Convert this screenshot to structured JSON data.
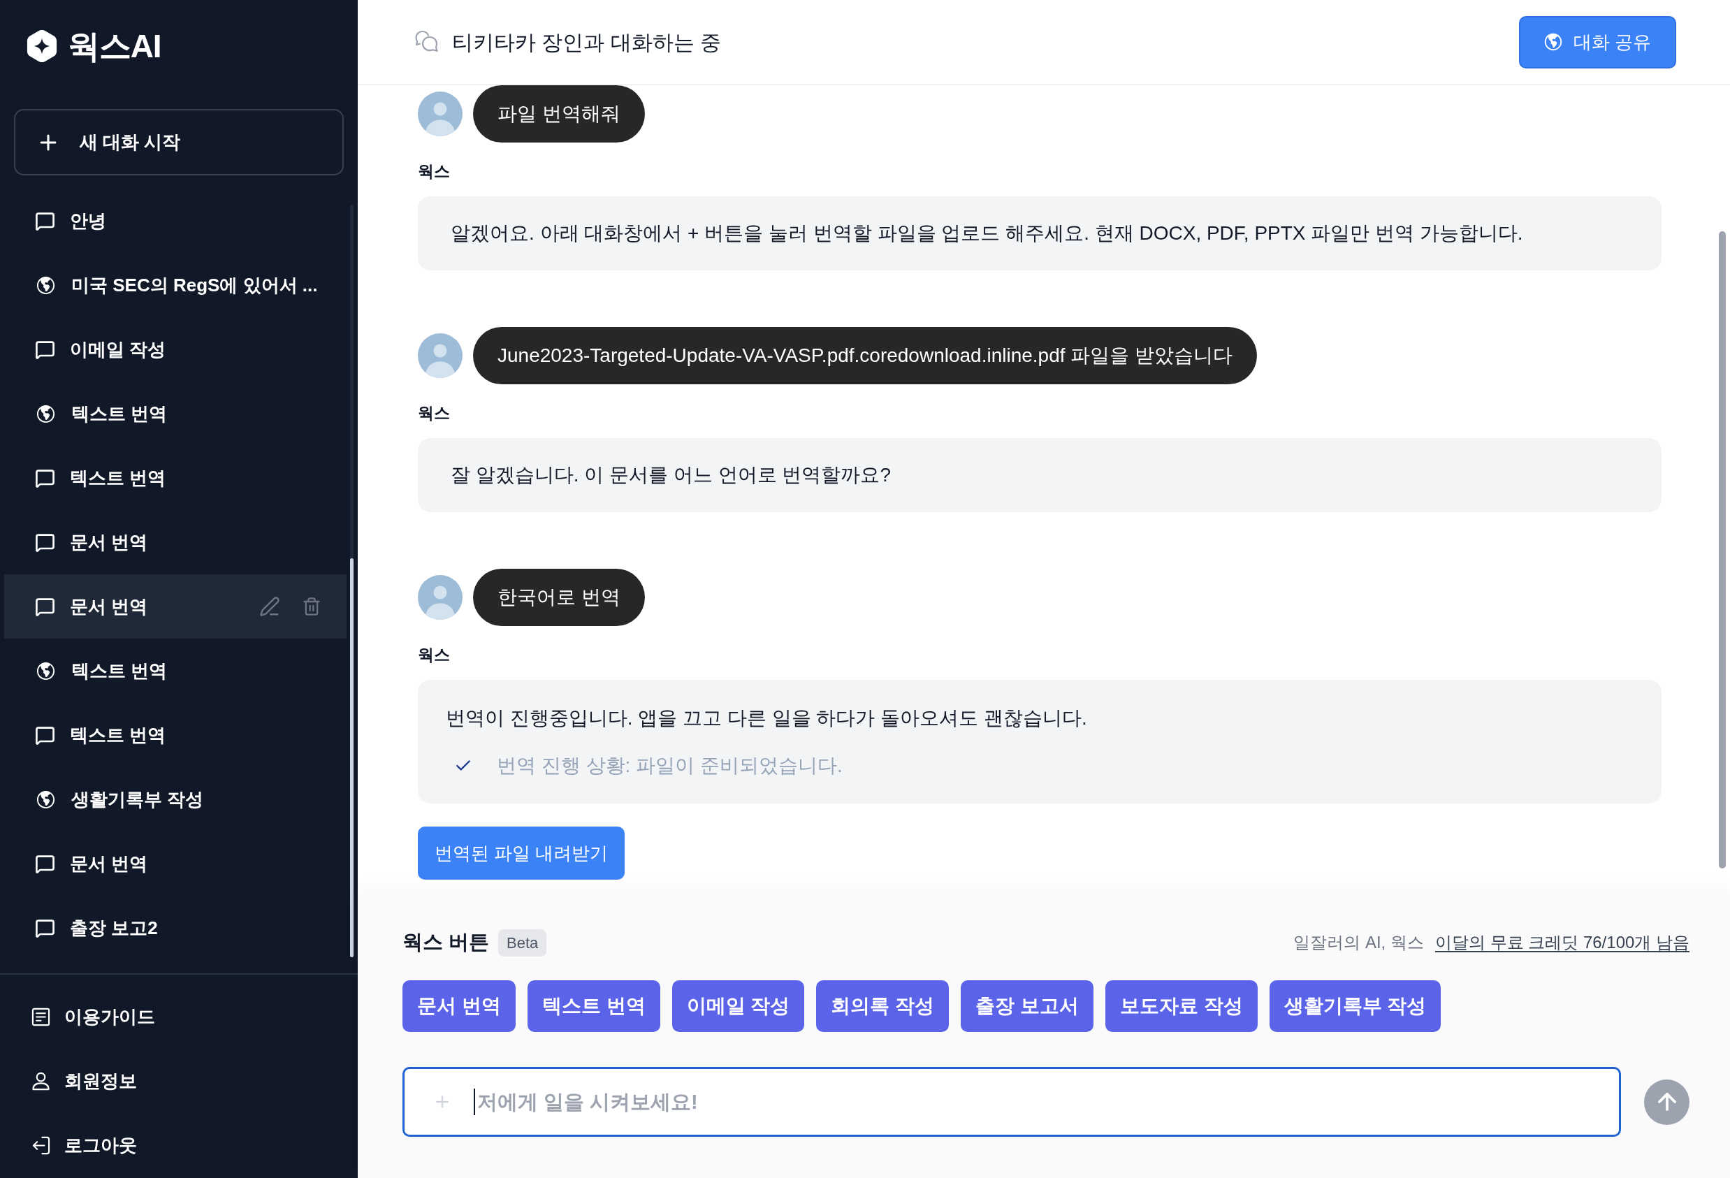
{
  "sidebar": {
    "logo": "웍스AI",
    "new_chat_button": "새 대화 시작",
    "conversations": [
      {
        "title": "안녕",
        "kind": "chat",
        "selected": false
      },
      {
        "title": "미국 SEC의 RegS에 있어서 ...",
        "kind": "globe",
        "selected": false
      },
      {
        "title": "이메일 작성",
        "kind": "chat",
        "selected": false
      },
      {
        "title": "텍스트 번역",
        "kind": "globe",
        "selected": false
      },
      {
        "title": "텍스트 번역",
        "kind": "chat",
        "selected": false
      },
      {
        "title": "문서 번역",
        "kind": "chat",
        "selected": false
      },
      {
        "title": "문서 번역",
        "kind": "chat",
        "selected": true
      },
      {
        "title": "텍스트 번역",
        "kind": "globe",
        "selected": false
      },
      {
        "title": "텍스트 번역",
        "kind": "chat",
        "selected": false
      },
      {
        "title": "생활기록부 작성",
        "kind": "globe",
        "selected": false
      },
      {
        "title": "문서 번역",
        "kind": "chat",
        "selected": false
      },
      {
        "title": "출장 보고2",
        "kind": "chat",
        "selected": false
      }
    ],
    "footer_items": [
      {
        "label": "이용가이드",
        "kind": "guide"
      },
      {
        "label": "회원정보",
        "kind": "account"
      },
      {
        "label": "로그아웃",
        "kind": "logout"
      }
    ]
  },
  "header": {
    "title": "티키타카 장인과 대화하는 중",
    "share_button": "대화 공유"
  },
  "messages": [
    {
      "kind": "user",
      "text": "파일 번역해줘"
    },
    {
      "kind": "assistant",
      "sender": "웍스",
      "text": "알겠어요. 아래 대화창에서 + 버튼을 눌러 번역할 파일을 업로드 해주세요. 현재 DOCX, PDF, PPTX 파일만 번역 가능합니다."
    },
    {
      "kind": "user",
      "text": "June2023-Targeted-Update-VA-VASP.pdf.coredownload.inline.pdf 파일을 받았습니다"
    },
    {
      "kind": "assistant",
      "sender": "웍스",
      "text": "잘 알겠습니다. 이 문서를 어느 언어로 번역할까요?"
    },
    {
      "kind": "user",
      "text": "한국어로 번역"
    },
    {
      "kind": "assistant",
      "sender": "웍스",
      "text": "번역이 진행중입니다. 앱을 끄고 다른 일을 하다가 돌아오셔도 괜찮습니다.",
      "status": {
        "text": "번역 진행 상황: 파일이 준비되었습니다.",
        "done": true
      },
      "download_button": "번역된 파일 내려받기"
    }
  ],
  "composer": {
    "title": "웍스 버튼",
    "badge": "Beta",
    "tagline": "일잘러의 AI, 웍스",
    "credits_link": "이달의 무료 크레딧 76/100개 남음",
    "quick_buttons": [
      "문서 번역",
      "텍스트 번역",
      "이메일 작성",
      "회의록 작성",
      "출장 보고서",
      "보도자료 작성",
      "생활기록부 작성"
    ],
    "input": {
      "placeholder": "저에게 일을 시켜보세요!",
      "focused": true
    }
  }
}
